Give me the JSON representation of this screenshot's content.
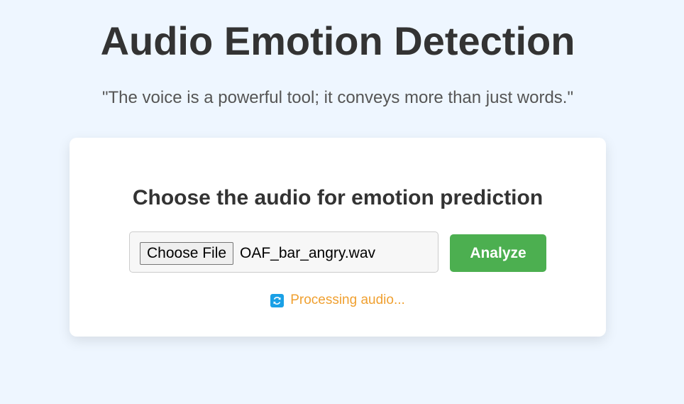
{
  "header": {
    "title": "Audio Emotion Detection",
    "quote": "\"The voice is a powerful tool; it conveys more than just words.\""
  },
  "card": {
    "heading": "Choose the audio for emotion prediction",
    "file_button_label": "Choose File",
    "selected_file": "OAF_bar_angry.wav",
    "analyze_label": "Analyze",
    "status_icon": "refresh-icon",
    "status_text": "Processing audio..."
  },
  "colors": {
    "background": "#eef6ff",
    "analyze_button": "#4caf50",
    "status_text": "#f0a030",
    "status_icon": "#1aa0e6"
  }
}
